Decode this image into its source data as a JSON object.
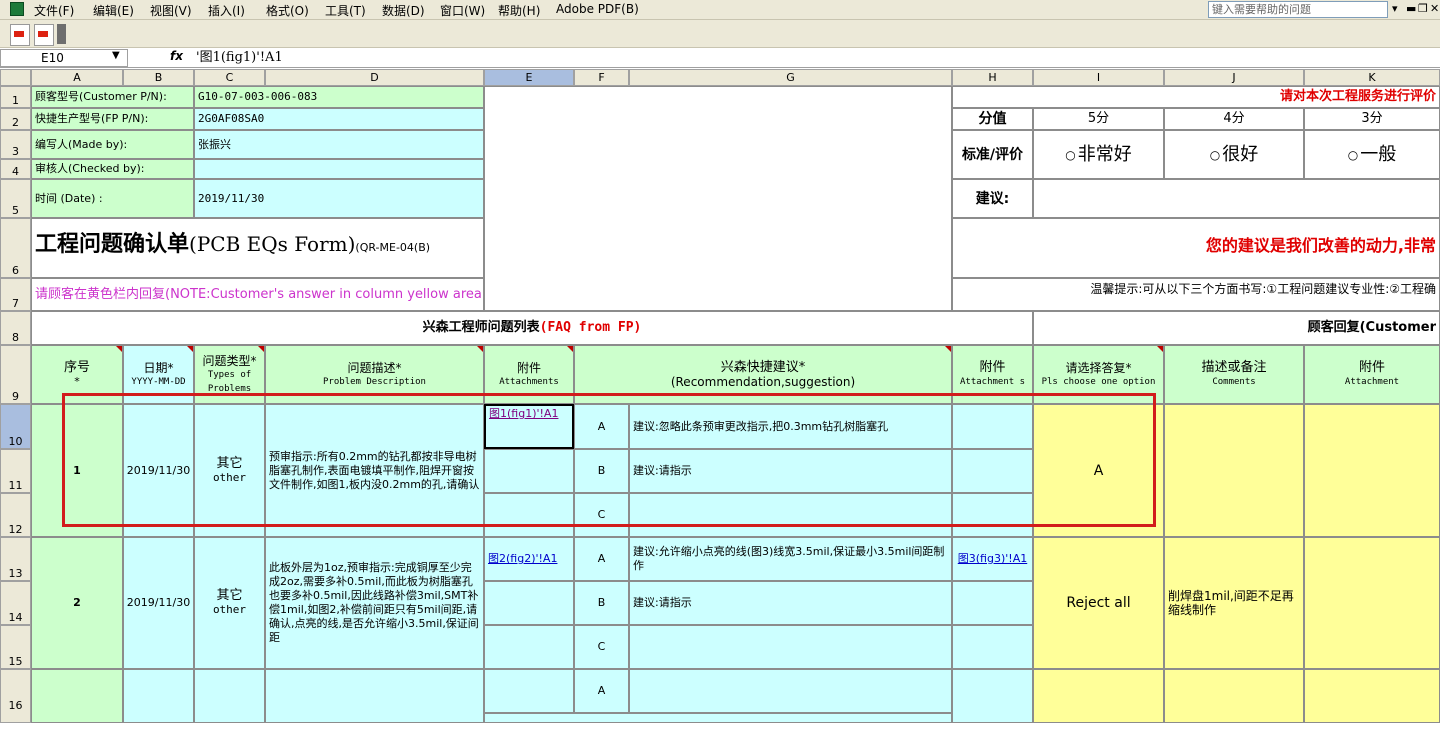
{
  "menubar": {
    "items": [
      "文件(F)",
      "编辑(E)",
      "视图(V)",
      "插入(I)",
      "格式(O)",
      "工具(T)",
      "数据(D)",
      "窗口(W)",
      "帮助(H)",
      "Adobe PDF(B)"
    ],
    "help_placeholder": "键入需要帮助的问题"
  },
  "formula_bar": {
    "name_box": "E10",
    "fx": "fx",
    "formula": "'图1(fig1)'!A1"
  },
  "columns": [
    "A",
    "B",
    "C",
    "D",
    "E",
    "F",
    "G",
    "H",
    "I",
    "J",
    "K"
  ],
  "rows": [
    "1",
    "2",
    "3",
    "4",
    "5",
    "6",
    "7",
    "8",
    "9",
    "10",
    "11",
    "12",
    "13",
    "14",
    "15",
    "16"
  ],
  "info": {
    "customer_pn_label": "顾客型号(Customer P/N):",
    "customer_pn": "G10-07-003-006-083",
    "fp_pn_label": "快捷生产型号(FP P/N):",
    "fp_pn": "2G0AF08SA0",
    "made_by_label": "编写人(Made by):",
    "made_by": "张振兴",
    "checked_by_label": "审核人(Checked by):",
    "checked_by": "",
    "date_label": "时间 (Date) :",
    "date": "2019/11/30"
  },
  "form_title": "工程问题确认单",
  "form_title_en": "(PCB EQs Form)",
  "form_code": "(QR-ME-04(B)",
  "note": "请顾客在黄色栏内回复(NOTE:Customer's answer in column yellow area)",
  "rating": {
    "banner": "请对本次工程服务进行评价",
    "score_label": "分值",
    "scores": [
      "5分",
      "4分",
      "3分"
    ],
    "criteria_label": "标准/评价",
    "options": [
      "非常好",
      "很好",
      "一般"
    ],
    "suggestion_label": "建议:",
    "motto": "您的建议是我们改善的动力,非常",
    "hint": "温馨提示:可从以下三个方面书写:①工程问题建议专业性:②工程确"
  },
  "section": {
    "fp_title": "兴森工程师问题列表",
    "fp_title_en": "(FAQ from FP)",
    "customer_title": "顾客回复(Customer"
  },
  "headers": {
    "no": "序号",
    "no_star": "*",
    "date": "日期*",
    "date_fmt": "YYYY-MM-DD",
    "type": "问题类型*",
    "type_en": "Types of Problems",
    "desc": "问题描述*",
    "desc_en": "Problem Description",
    "attach": "附件",
    "attach_en": "Attachments",
    "recommend": "兴森快捷建议*",
    "recommend_en": "(Recommendation,suggestion)",
    "attach2": "附件",
    "attach2_en": "Attachment s",
    "answer": "请选择答复*",
    "answer_en": "Pls choose one option",
    "comments": "描述或备注",
    "comments_en": "Comments",
    "attach3": "附件",
    "attach3_en": "Attachment"
  },
  "entries": [
    {
      "no": "1",
      "date": "2019/11/30",
      "type": "其它",
      "type_en": "other",
      "desc": "预审指示:所有0.2mm的钻孔都按非导电树脂塞孔制作,表面电镀填平制作,阻焊开窗按文件制作,如图1,板内没0.2mm的孔,请确认",
      "attach": "图1(fig1)'!A1",
      "options": [
        "A",
        "B",
        "C"
      ],
      "suggestions": [
        "建议:忽略此条预审更改指示,把0.3mm钻孔树脂塞孔",
        "建议:请指示",
        ""
      ],
      "attach2": "",
      "answer": "A",
      "comment": ""
    },
    {
      "no": "2",
      "date": "2019/11/30",
      "type": "其它",
      "type_en": "other",
      "desc": "此板外层为1oz,预审指示:完成铜厚至少完成2oz,需要多补0.5mil,而此板为树脂塞孔也要多补0.5mil,因此线路补偿3mil,SMT补偿1mil,如图2,补偿前间距只有5mil间距,请确认,点亮的线,是否允许缩小3.5mil,保证间距",
      "attach": "图2(fig2)'!A1",
      "options": [
        "A",
        "B",
        "C"
      ],
      "suggestions": [
        "建议:允许缩小点亮的线(图3)线宽3.5mil,保证最小3.5mil间距制作",
        "建议:请指示",
        ""
      ],
      "attach2": "图3(fig3)'!A1",
      "answer": "Reject all",
      "comment": "削焊盘1mil,间距不足再缩线制作"
    }
  ],
  "row16_option": "A"
}
